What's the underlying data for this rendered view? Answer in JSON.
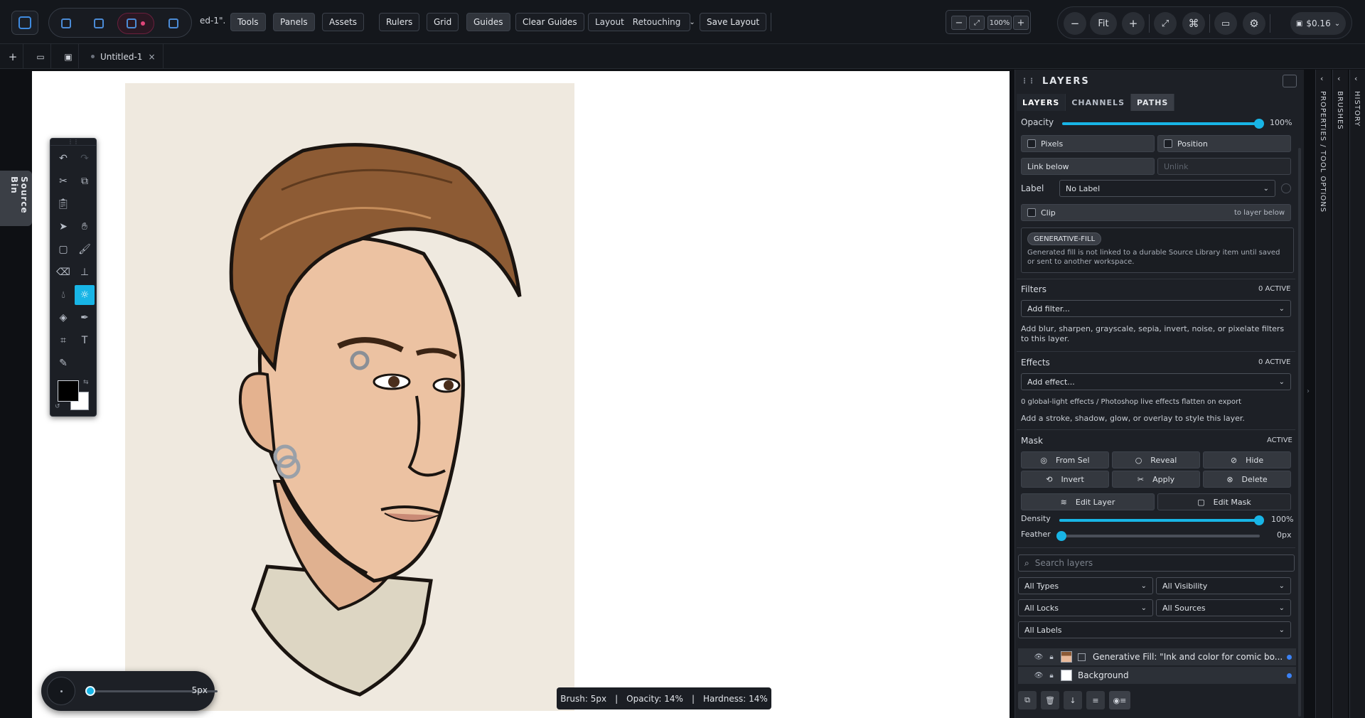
{
  "toolbar": {
    "doc_fragment": "ed-1\".",
    "tools": "Tools",
    "panels": "Panels",
    "assets": "Assets",
    "rulers": "Rulers",
    "grid": "Grid",
    "guides": "Guides",
    "clear_guides": "Clear Guides",
    "layout_label": "Layout",
    "layout_value": "Retouching",
    "save_layout": "Save Layout",
    "zoom_value": "100%",
    "fit": "Fit",
    "cost": "$0.16"
  },
  "tabs": {
    "document": "Untitled-1"
  },
  "left": {
    "source_bin": "Source Bin"
  },
  "brush": {
    "size_value": "5px",
    "size_fraction": 0.0
  },
  "status": {
    "brush": "Brush: 5px",
    "opacity": "Opacity: 14%",
    "hardness": "Hardness: 14%",
    "separator": "|"
  },
  "panel": {
    "title": "LAYERS",
    "tabs": [
      "LAYERS",
      "CHANNELS",
      "PATHS"
    ],
    "opacity_label": "Opacity",
    "opacity_value": "100%",
    "pixels": "Pixels",
    "position": "Position",
    "link_below": "Link below",
    "unlink": "Unlink",
    "label_label": "Label",
    "label_value": "No Label",
    "clip": "Clip",
    "clip_note": "to layer below",
    "badge": "GENERATIVE-FILL",
    "info": "Generated fill is not linked to a durable Source Library item until saved or sent to another workspace.",
    "filters_label": "Filters",
    "filters_active": "0 ACTIVE",
    "filters_select": "Add filter...",
    "filters_note": "Add blur, sharpen, grayscale, sepia, invert, noise, or pixelate filters to this layer.",
    "effects_label": "Effects",
    "effects_active": "0 ACTIVE",
    "effects_select": "Add effect...",
    "effects_note1": "0 global-light effects / Photoshop live effects flatten on export",
    "effects_note2": "Add a stroke, shadow, glow, or overlay to style this layer.",
    "mask_label": "Mask",
    "mask_active": "ACTIVE",
    "mask_buttons": [
      "From Sel",
      "Reveal",
      "Hide",
      "Invert",
      "Apply",
      "Delete"
    ],
    "edit_layer": "Edit Layer",
    "edit_mask": "Edit Mask",
    "density_label": "Density",
    "density_value": "100%",
    "feather_label": "Feather",
    "feather_value": "0px",
    "search_placeholder": "Search layers",
    "filter_types": "All Types",
    "filter_visibility": "All Visibility",
    "filter_locks": "All Locks",
    "filter_sources": "All Sources",
    "filter_labels": "All Labels",
    "layers": [
      {
        "name": "Generative Fill: \"Ink and color for comic bo..."
      },
      {
        "name": "Background"
      }
    ]
  },
  "side_tabs": {
    "properties": "PROPERTIES / TOOL OPTIONS",
    "brushes": "BRUSHES",
    "history": "HISTORY"
  },
  "colors": {
    "accent": "#18b5e6",
    "layer_dot": "#3b82f6"
  }
}
